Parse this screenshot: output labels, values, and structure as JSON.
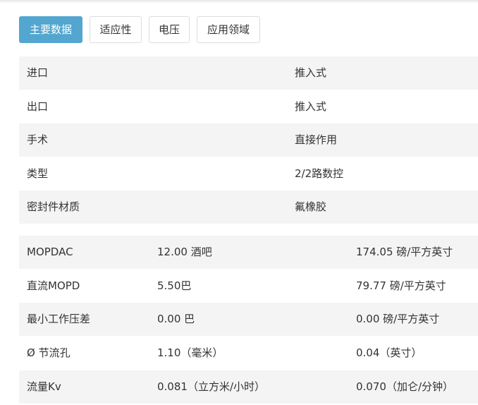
{
  "tabs": [
    {
      "label": "主要数据",
      "active": true
    },
    {
      "label": "适应性",
      "active": false
    },
    {
      "label": "电压",
      "active": false
    },
    {
      "label": "应用领域",
      "active": false
    }
  ],
  "spec_table": [
    {
      "key": "进口",
      "value": "推入式"
    },
    {
      "key": "出口",
      "value": "推入式"
    },
    {
      "key": "手术",
      "value": "直接作用"
    },
    {
      "key": "类型",
      "value": "2/2路数控"
    },
    {
      "key": "密封件材质",
      "value": "氟橡胶"
    }
  ],
  "pressure_table": [
    {
      "key": "MOPDAC",
      "metric": "12.00 酒吧",
      "imperial": "174.05 磅/平方英寸"
    },
    {
      "key": "直流MOPD",
      "metric": "5.50巴",
      "imperial": "79.77 磅/平方英寸"
    },
    {
      "key": "最小工作压差",
      "metric": "0.00 巴",
      "imperial": "0.00 磅/平方英寸"
    },
    {
      "key": "Ø 节流孔",
      "metric": "1.10（毫米）",
      "imperial": "0.04（英寸）"
    },
    {
      "key": "流量Kv",
      "metric": "0.081（立方米/小时）",
      "imperial": "0.070（加仑/分钟）"
    }
  ],
  "colors": {
    "active_tab": "#52a6cf",
    "row_alt": "#f4f4f4"
  }
}
